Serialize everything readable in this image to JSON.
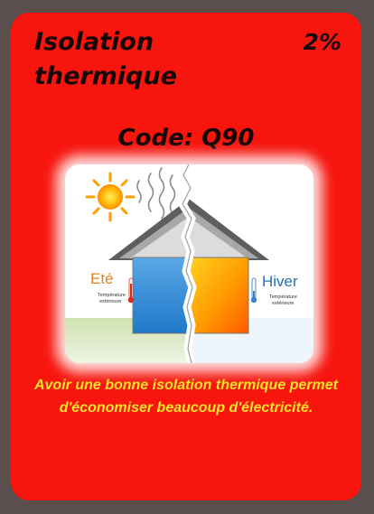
{
  "card": {
    "title": "Isolation thermique",
    "percentage": "2%",
    "code": "Code: Q90",
    "description": "Avoir une bonne isolation thermique permet d'économiser beaucoup d'électricité."
  },
  "illustration": {
    "summer_label": "Eté",
    "summer_caption_line1": "Température",
    "summer_caption_line2": "extérieure",
    "winter_label": "Hiver",
    "winter_caption_line1": "Température",
    "winter_caption_line2": "extérieure",
    "summer_icons": [
      "sun-icon",
      "heat-wave-icon",
      "thermometer-icon"
    ],
    "winter_icons": [
      "thermometer-icon"
    ]
  },
  "colors": {
    "background": "#5b4e4f",
    "card": "#f7150e",
    "title_text": "#160707",
    "description_text": "#fbe32a",
    "summer_wall": "#2f8fdc",
    "winter_wall": "#ff7a00",
    "roof": "#9a9a9a"
  }
}
